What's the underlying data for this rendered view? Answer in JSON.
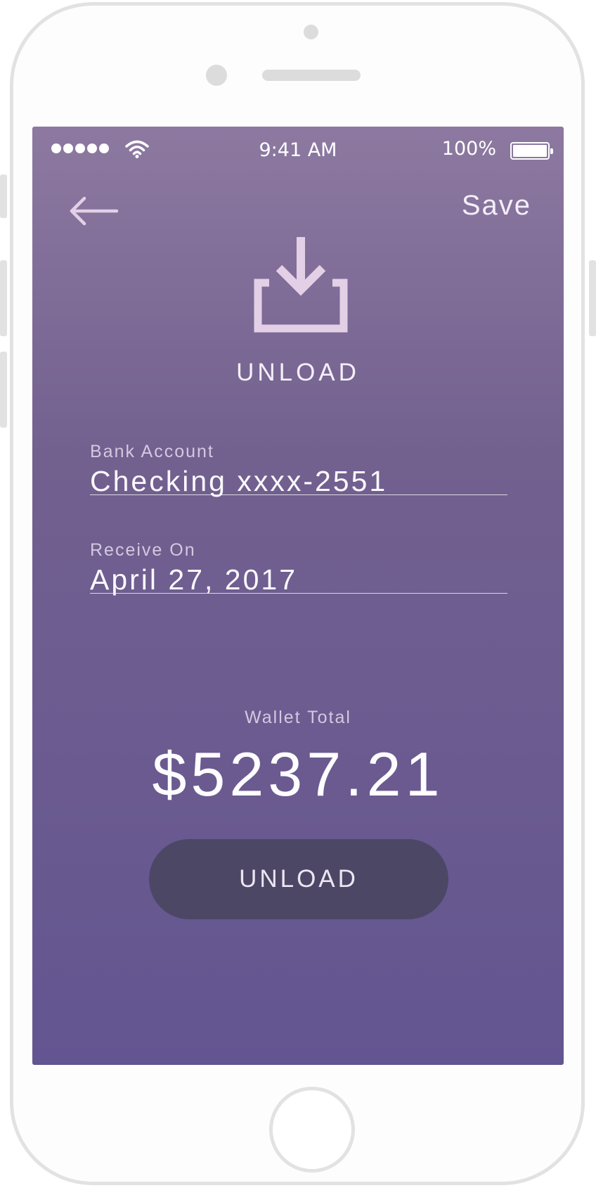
{
  "status_bar": {
    "signal_icon": "signal-dots-icon",
    "wifi_icon": "wifi-icon",
    "time": "9:41 AM",
    "battery_percent": "100%",
    "battery_icon": "battery-icon"
  },
  "nav": {
    "back_icon": "arrow-left-icon",
    "save_label": "Save"
  },
  "hero": {
    "icon": "download-tray-icon",
    "title": "UNLOAD"
  },
  "form": {
    "bank_account": {
      "label": "Bank Account",
      "value": "Checking xxxx-2551"
    },
    "receive_on": {
      "label": "Receive On",
      "value": "April 27, 2017"
    }
  },
  "wallet": {
    "label": "Wallet Total",
    "amount": "$5237.21"
  },
  "actions": {
    "unload_label": "UNLOAD"
  },
  "colors": {
    "gradient_top": "#8d79a0",
    "gradient_bottom": "#635591",
    "button_bg": "#4d4766",
    "icon_tint": "#e3d0e7"
  }
}
